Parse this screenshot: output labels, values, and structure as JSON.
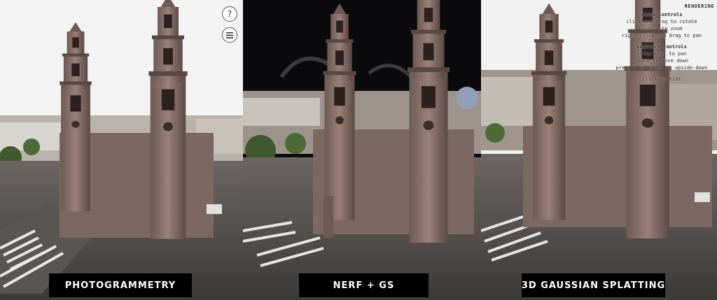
{
  "panels": [
    {
      "caption": "PHOTOGRAMMETRY"
    },
    {
      "caption": "NERF + GS"
    },
    {
      "caption": "3D GAUSSIAN SPLATTING"
    }
  ],
  "viewer": {
    "help_label": "?",
    "brand": "RENDERING",
    "mouse_title": "mouse controls",
    "mouse_lines": [
      "click and drag to rotate",
      "scroll to zoom",
      "right click and drag to pan"
    ],
    "keyboard_title": "keyboard controls",
    "keyboard_lines": [
      "arrow keys to pan",
      "space to move down",
      "press F if model is upside-down"
    ],
    "hide_label": "click to hide"
  },
  "icons": {
    "help": "question-icon",
    "menu": "hamburger-icon"
  },
  "colors": {
    "caption_bg": "#000000",
    "caption_text": "#ffffff",
    "stone": "#8a7268",
    "sky_light": "#f2f2f2",
    "sky_dark": "#0b0b0d"
  }
}
